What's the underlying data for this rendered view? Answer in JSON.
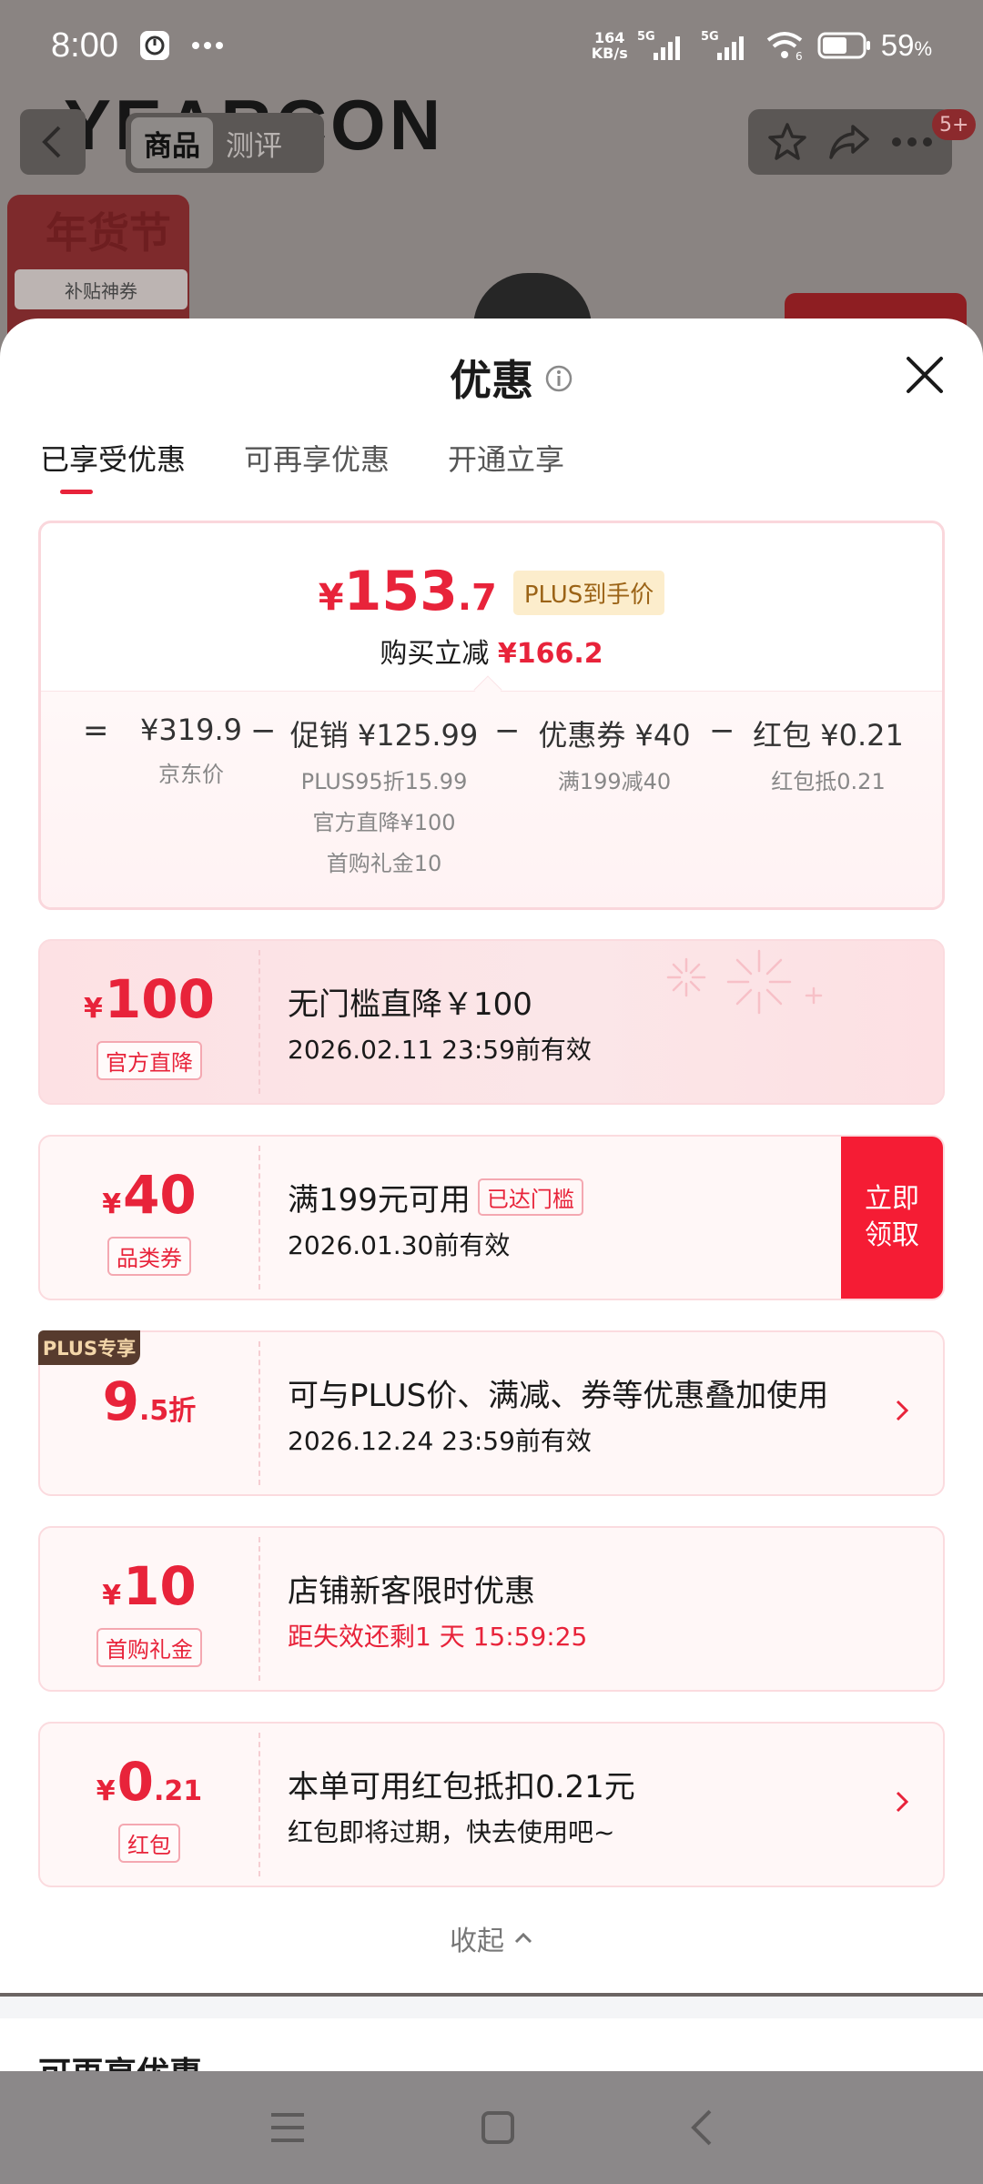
{
  "status_bar": {
    "time": "8:00",
    "net_speed_value": "164",
    "net_speed_unit": "KB/s",
    "battery": "59",
    "battery_unit": "%"
  },
  "background_page": {
    "brand": "YEARCON",
    "tabs": [
      "商品",
      "测评"
    ],
    "badge": "5+",
    "promo_title": "年货节",
    "promo_sub": "补贴神券"
  },
  "sheet": {
    "title": "优惠",
    "tabs": [
      "已享受优惠",
      "可再享优惠",
      "开通立享"
    ]
  },
  "summary": {
    "currency": "¥",
    "price_int": "153",
    "price_dec": ".7",
    "price_tag": "PLUS到手价",
    "instant_label": "购买立减",
    "instant_value": "¥166.2",
    "calc": [
      {
        "op": "=",
        "value": "¥319.9",
        "subs": [
          "京东价"
        ]
      },
      {
        "op": "−",
        "value": "促销 ¥125.99",
        "subs": [
          "PLUS95折15.99",
          "官方直降¥100",
          "首购礼金10"
        ]
      },
      {
        "op": "−",
        "value": "优惠券 ¥40",
        "subs": [
          "满199减40"
        ]
      },
      {
        "op": "−",
        "value": "红包 ¥0.21",
        "subs": [
          "红包抵0.21"
        ]
      }
    ]
  },
  "coupons": [
    {
      "sym": "¥",
      "big": "100",
      "small": "",
      "tag": "官方直降",
      "title": "无门槛直降￥100",
      "sub": "2026.02.11 23:59前有效"
    },
    {
      "sym": "¥",
      "big": "40",
      "small": "",
      "tag": "品类券",
      "title": "满199元可用",
      "reached": "已达门槛",
      "sub": "2026.01.30前有效",
      "action": "立即领取"
    },
    {
      "label": "PLUS专享",
      "big": "9",
      "small": ".5折",
      "title": "可与PLUS价、满减、券等优惠叠加使用",
      "sub": "2026.12.24 23:59前有效"
    },
    {
      "sym": "¥",
      "big": "10",
      "small": "",
      "tag": "首购礼金",
      "title": "店铺新客限时优惠",
      "sub": "距失效还剩1 天 15:59:25"
    },
    {
      "sym": "¥",
      "big": "0",
      "small": ".21",
      "tag": "红包",
      "title": "本单可用红包抵扣0.21元",
      "sub": "红包即将过期，快去使用吧~"
    }
  ],
  "collapse_label": "收起",
  "next_section_title": "可再享优惠",
  "colors": {
    "accent": "#e8233a",
    "claim": "#f51c34",
    "plus_bg": "#573b2e"
  }
}
